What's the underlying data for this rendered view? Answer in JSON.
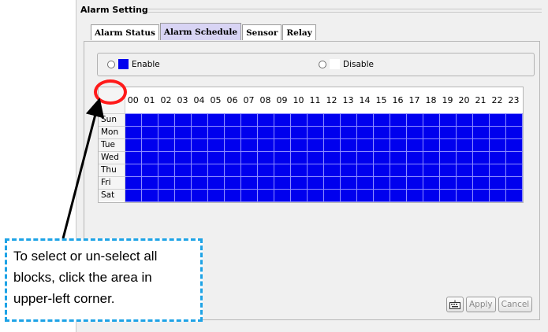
{
  "window": {
    "title": "Alarm Setting"
  },
  "tabs": [
    {
      "label": "Alarm Status",
      "active": false
    },
    {
      "label": "Alarm Schedule",
      "active": true
    },
    {
      "label": "Sensor",
      "active": false
    },
    {
      "label": "Relay",
      "active": false
    }
  ],
  "radio": {
    "enable_label": "Enable",
    "enable_color": "#0000ee",
    "disable_label": "Disable",
    "disable_color": "#ffffff"
  },
  "schedule": {
    "hours": [
      "00",
      "01",
      "02",
      "03",
      "04",
      "05",
      "06",
      "07",
      "08",
      "09",
      "10",
      "11",
      "12",
      "13",
      "14",
      "15",
      "16",
      "17",
      "18",
      "19",
      "20",
      "21",
      "22",
      "23"
    ],
    "days": [
      "Sun",
      "Mon",
      "Tue",
      "Wed",
      "Thu",
      "Fri",
      "Sat"
    ],
    "all_enabled": true
  },
  "buttons": {
    "icon": "keyboard-icon",
    "apply": "Apply",
    "cancel": "Cancel"
  },
  "callout": {
    "text": "To select or un-select all\nblocks, click the area in\nupper-left corner."
  }
}
